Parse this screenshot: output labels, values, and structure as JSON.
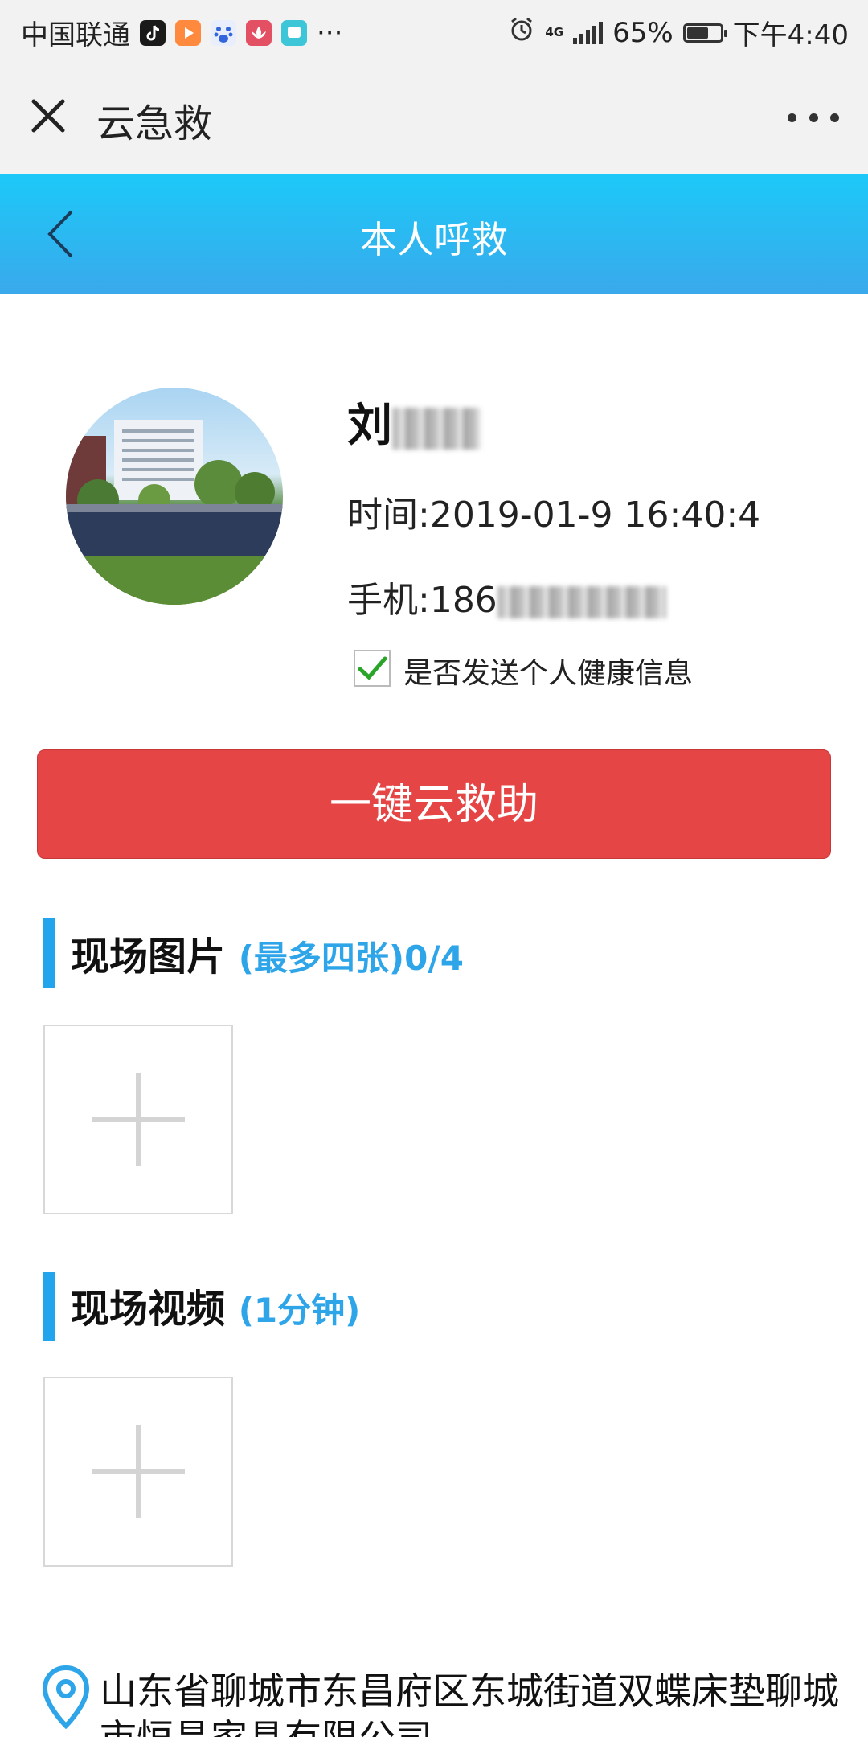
{
  "status_bar": {
    "carrier": "中国联通",
    "network": "4G",
    "battery": "65%",
    "battery_level": 0.65,
    "time": "下午4:40"
  },
  "title_bar": {
    "title": "云急救"
  },
  "header": {
    "title": "本人呼救"
  },
  "profile": {
    "name_visible": "刘",
    "time_label": "时间:2019-01-9 16:40:4",
    "phone_prefix": "手机:186",
    "send_health_label": "是否发送个人健康信息",
    "send_health_checked": true
  },
  "rescue_button": {
    "label": "一键云救助"
  },
  "photos": {
    "title": "现场图片",
    "hint": "(最多四张)0/4"
  },
  "video": {
    "title": "现场视频",
    "hint": "(1分钟)"
  },
  "location": {
    "address": "山东省聊城市东昌府区东城街道双蝶床垫聊城市恒昌家具有限公司"
  },
  "colors": {
    "header_blue_top": "#1cc9f8",
    "header_blue_bottom": "#3aa9ec",
    "accent_blue": "#22a5ec",
    "rescue_red": "#e64545",
    "check_green": "#2aa52a"
  }
}
